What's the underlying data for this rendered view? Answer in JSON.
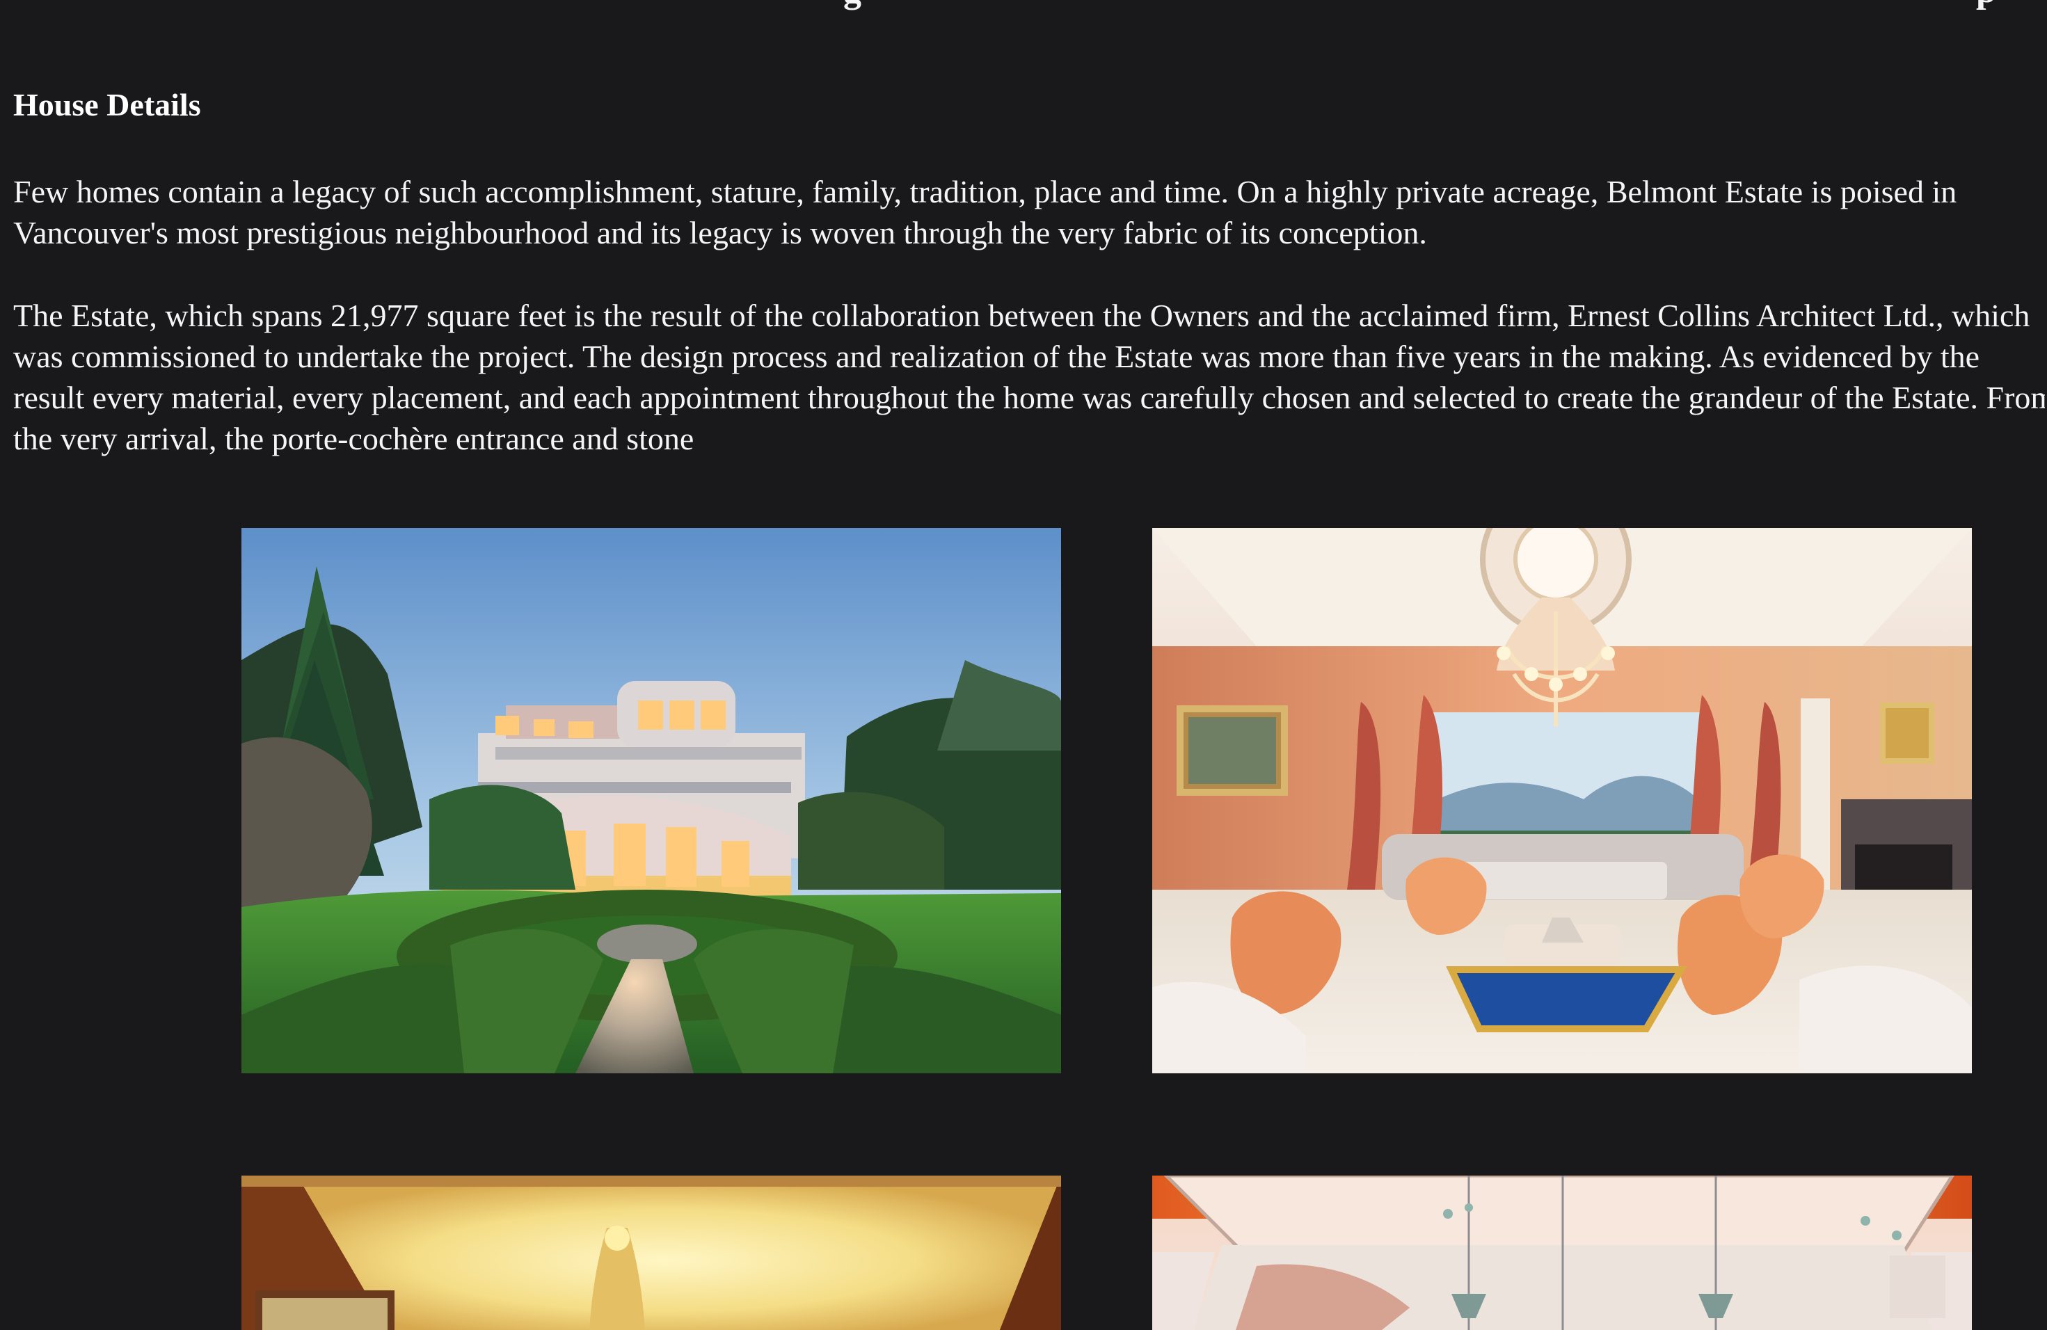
{
  "page": {
    "background": "#19181a",
    "section_title": "House Details",
    "paragraph_1": [
      "Few homes contain a legacy of such accomplishment, stature, family, tradition, place and time. On a highly private acreage, Belmont Estate is poised in",
      "Vancouver's most prestigious neighbourhood and its legacy is woven through the very fabric of its conception."
    ],
    "paragraph_2": [
      "The Estate, which spans 21,977 square feet is the result of the collaboration between the Owners and the acclaimed firm, Ernest Collins Architect Ltd., which",
      "was commissioned to undertake the project. The design process and realization of the Estate was more than five years in the making. As evidenced by the",
      "result every material, every placement, and each appointment throughout the home was carefully chosen and selected to create the grandeur of the Estate. From",
      "the very arrival, the porte-cochère entrance and stone"
    ]
  },
  "images": [
    {
      "name": "estate-exterior-garden-photo",
      "subject": "mansion exterior with formal garden"
    },
    {
      "name": "living-room-chandelier-photo",
      "subject": "formal living room with chandelier"
    },
    {
      "name": "wood-paneled-room-photo",
      "subject": "wood-paneled interior ceiling"
    },
    {
      "name": "ornate-ceiling-room-photo",
      "subject": "ornate lit ceiling room"
    }
  ],
  "accent_colors": {
    "sky": "#8fb6de",
    "lawn": "#3f8b2f",
    "peach": "#e99a69",
    "blue_table": "#224c9d",
    "gold": "#d3a145"
  }
}
